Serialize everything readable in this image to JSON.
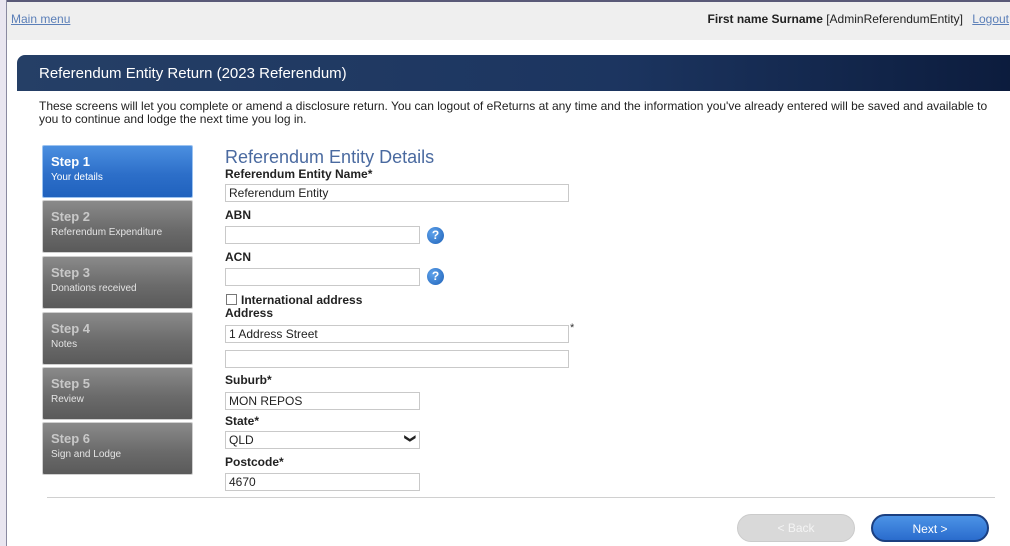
{
  "topbar": {
    "main_menu": "Main menu",
    "user_name": "First name Surname",
    "user_role": "[AdminReferendumEntity]",
    "logout": "Logout"
  },
  "header": {
    "title": "Referendum Entity Return (2023 Referendum)"
  },
  "intro": "These screens will let you complete or amend a disclosure return. You can logout of eReturns at any time and the information you've already entered will be saved and available to you to continue and lodge the next time you log in.",
  "steps": [
    {
      "num": "Step 1",
      "label": "Your details",
      "active": true
    },
    {
      "num": "Step 2",
      "label": "Referendum Expenditure",
      "active": false
    },
    {
      "num": "Step 3",
      "label": "Donations received",
      "active": false
    },
    {
      "num": "Step 4",
      "label": "Notes",
      "active": false
    },
    {
      "num": "Step 5",
      "label": "Review",
      "active": false
    },
    {
      "num": "Step 6",
      "label": "Sign and Lodge",
      "active": false
    }
  ],
  "form": {
    "heading": "Referendum Entity Details",
    "entity_name_label": "Referendum Entity Name*",
    "entity_name_value": "Referendum Entity",
    "abn_label": "ABN",
    "abn_value": "",
    "acn_label": "ACN",
    "acn_value": "",
    "help_glyph": "?",
    "international_label": "International address",
    "address_label": "Address",
    "address_line1": "1 Address Street",
    "address_line2": "",
    "address_required": "*",
    "suburb_label": "Suburb*",
    "suburb_value": "MON REPOS",
    "state_label": "State*",
    "state_value": "QLD",
    "postcode_label": "Postcode*",
    "postcode_value": "4670"
  },
  "buttons": {
    "back": "< Back",
    "next": "Next >"
  },
  "colors": {
    "title_bar": "#1c3560",
    "active_step": "#2d6fc9",
    "inactive_step": "#6b6b6b",
    "link": "#5b7fb8",
    "heading": "#4a6aa0"
  },
  "icons": {
    "help": "question-circle-icon",
    "dropdown": "chevron-down-icon"
  }
}
